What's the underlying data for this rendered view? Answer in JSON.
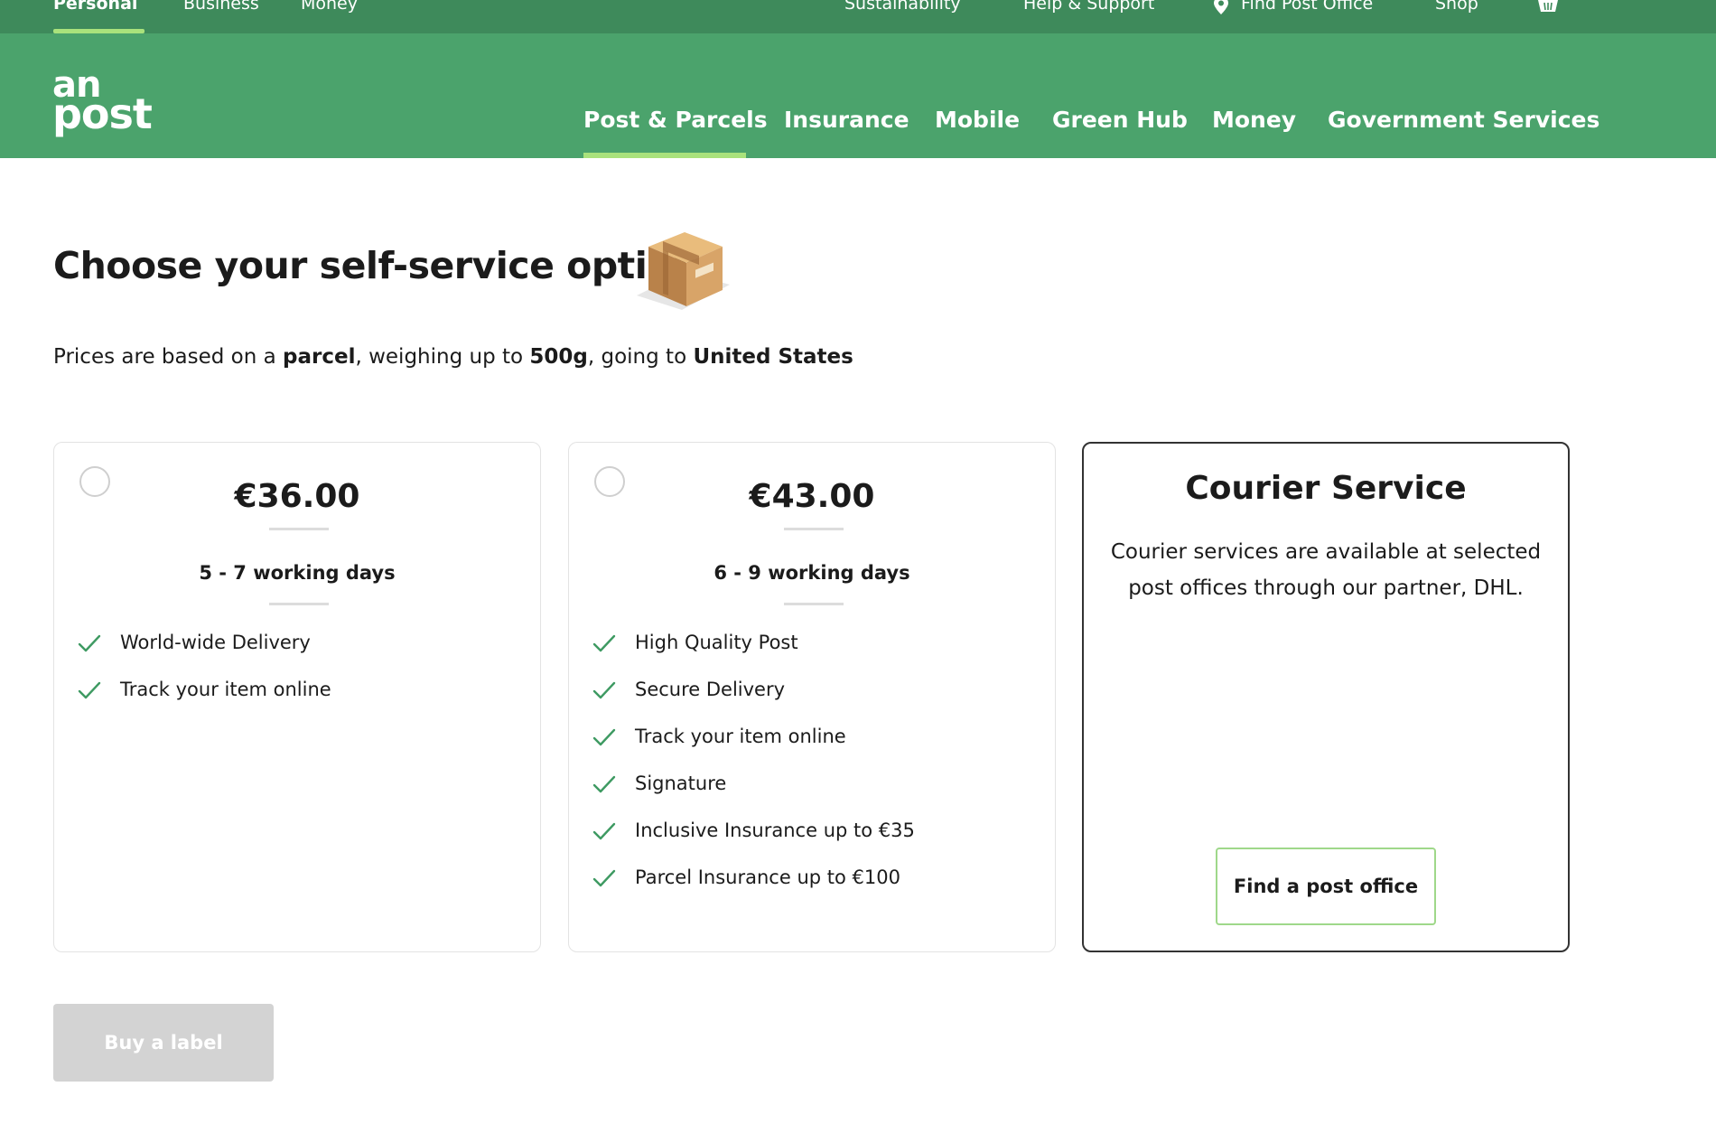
{
  "topbar": {
    "tabs": [
      {
        "label": "Personal",
        "active": true
      },
      {
        "label": "Business",
        "active": false
      },
      {
        "label": "Money",
        "active": false
      }
    ],
    "links": {
      "sustainability": "Sustainability",
      "help": "Help & Support",
      "find_post_office": "Find Post Office",
      "shop": "Shop"
    }
  },
  "header": {
    "logo_line1": "an",
    "logo_line2": "post",
    "nav": [
      {
        "label": "Post & Parcels",
        "active": true
      },
      {
        "label": "Insurance"
      },
      {
        "label": "Mobile"
      },
      {
        "label": "Green Hub"
      },
      {
        "label": "Money"
      },
      {
        "label": "Government Services"
      }
    ]
  },
  "main": {
    "title": "Choose your self-service option",
    "subtitle": {
      "prefix": "Prices are based on a ",
      "item": "parcel",
      "mid1": ", weighing up to ",
      "weight": "500g",
      "mid2": ", going to ",
      "destination": "United States"
    },
    "options": [
      {
        "price": "€36.00",
        "days": "5 - 7 working days",
        "features": [
          "World-wide Delivery",
          "Track your item online"
        ]
      },
      {
        "price": "€43.00",
        "days": "6 - 9 working days",
        "features": [
          "High Quality Post",
          "Secure Delivery",
          "Track your item online",
          "Signature",
          "Inclusive Insurance up to €35",
          "Parcel Insurance up to €100"
        ]
      }
    ],
    "courier": {
      "title": "Courier Service",
      "text": "Courier services are available at selected post offices through our partner, DHL.",
      "button": "Find a post office"
    },
    "buy_button": "Buy a label"
  },
  "colors": {
    "topbar": "#3e8a5b",
    "header": "#4ba36c",
    "accent": "#a9e27c",
    "check": "#3e9a62",
    "disabled_button": "#d3d3d3"
  }
}
